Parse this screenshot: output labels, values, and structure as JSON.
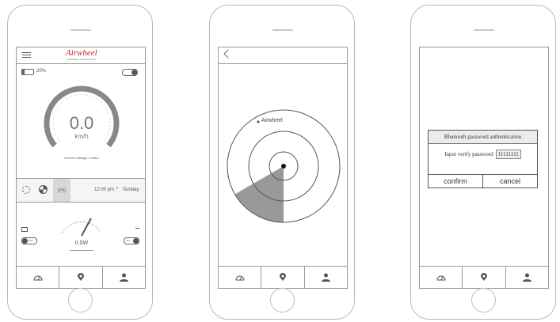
{
  "phone1": {
    "brand": "Airwheel",
    "brand_sub": "AIRWHEEL TECHNOLOGY",
    "battery": "20%",
    "speed": "0.0",
    "unit": "km/h",
    "mileage": "Current mileage: 0.00km",
    "time": "12:00 pm",
    "dot": "•",
    "day": "Sunday",
    "power": "0.0W",
    "toggle_left": "OFF",
    "toggle_right": "ON",
    "icons": [
      "settings-icon",
      "pie-icon",
      "signal-icon"
    ]
  },
  "phone2": {
    "device_label": "Airwheel"
  },
  "phone3": {
    "dialog_title": "Bluetooth password authentication",
    "input_label": "Input verify password",
    "password_value": "11111111",
    "confirm": "confirm",
    "cancel": "cancel"
  },
  "tabbar": [
    "speedometer-icon",
    "location-icon",
    "user-icon"
  ],
  "colors": {
    "brand": "#c8202a",
    "gauge": "#888888",
    "line": "#9a9a9a"
  }
}
